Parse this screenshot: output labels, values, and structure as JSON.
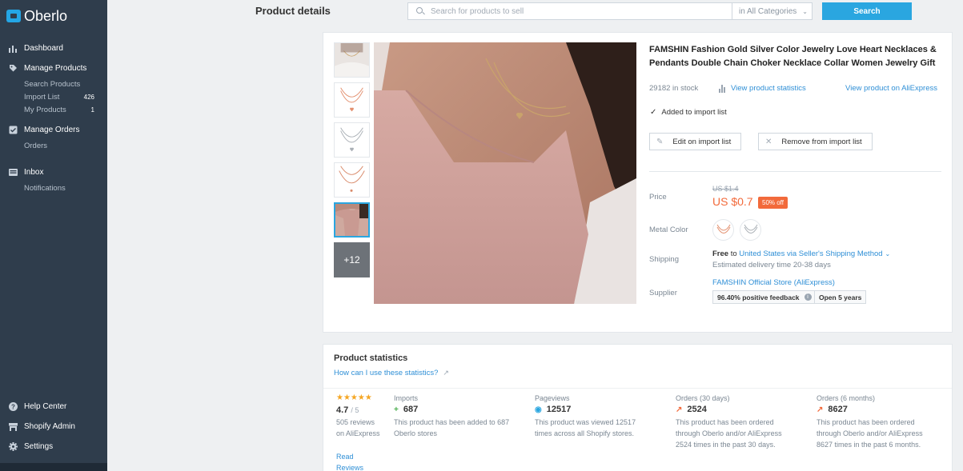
{
  "brand": {
    "name": "Oberlo"
  },
  "sidebar": {
    "sections": [
      {
        "label": "Dashboard",
        "icon": "bar-chart-icon",
        "items": []
      },
      {
        "label": "Manage Products",
        "icon": "tag-icon",
        "items": [
          {
            "label": "Search Products",
            "count": ""
          },
          {
            "label": "Import List",
            "count": "426"
          },
          {
            "label": "My Products",
            "count": "1"
          }
        ]
      },
      {
        "label": "Manage Orders",
        "icon": "checkbox-icon",
        "items": [
          {
            "label": "Orders",
            "count": ""
          }
        ]
      },
      {
        "label": "Inbox",
        "icon": "inbox-icon",
        "items": [
          {
            "label": "Notifications",
            "count": ""
          }
        ]
      }
    ],
    "bottom": [
      {
        "label": "Help Center",
        "icon": "help-icon"
      },
      {
        "label": "Shopify Admin",
        "icon": "store-icon"
      },
      {
        "label": "Settings",
        "icon": "gear-icon"
      }
    ]
  },
  "header": {
    "title": "Product details",
    "search_placeholder": "Search for products to sell",
    "category": "in All Categories",
    "search_button": "Search"
  },
  "product": {
    "title": "FAMSHIN Fashion Gold Silver Color Jewelry Love Heart Necklaces & Pendants Double Chain Choker Necklace Collar Women Jewelry Gift",
    "stock": "29182 in stock",
    "stats_link": "View product statistics",
    "aliexpress_link": "View product on AliExpress",
    "added_text": "Added to import list",
    "edit_button": "Edit on import list",
    "remove_button": "Remove from import list",
    "more_images": "+12",
    "price_label": "Price",
    "old_price": "US $1.4",
    "new_price": "US $0.7",
    "discount": "50% off",
    "metal_color_label": "Metal Color",
    "shipping_label": "Shipping",
    "shipping_free": "Free",
    "shipping_to": "to",
    "shipping_link": "United States via Seller's Shipping Method",
    "shipping_eta": "Estimated delivery time 20-38 days",
    "supplier_label": "Supplier",
    "supplier_name": "FAMSHIN Official Store (AliExpress)",
    "feedback": "96.40% positive feedback",
    "store_age": "Open 5 years"
  },
  "stats": {
    "title": "Product statistics",
    "help_link": "How can I use these statistics?",
    "stars": "★★★★★",
    "rating": "4.7",
    "rating_of": "/ 5",
    "reviews_text": "505 reviews on AliExpress",
    "reviews_link": "Read Reviews",
    "columns": [
      {
        "label": "Imports",
        "icon": "plus-icon",
        "value": "687",
        "desc": "This product has been added to 687 Oberlo stores"
      },
      {
        "label": "Pageviews",
        "icon": "eye-icon",
        "value": "12517",
        "desc": "This product was viewed 12517 times across all Shopify stores."
      },
      {
        "label": "Orders (30 days)",
        "icon": "trend-chart-icon",
        "value": "2524",
        "desc": "This product has been ordered through Oberlo and/or AliExpress 2524 times in the past 30 days."
      },
      {
        "label": "Orders (6 months)",
        "icon": "trend-chart-icon",
        "value": "8627",
        "desc": "This product has been ordered through Oberlo and/or AliExpress 8627 times in the past 6 months."
      }
    ]
  },
  "colors": {
    "accent": "#2aa6e0",
    "sidebar": "#2f3d4c",
    "price": "#f26a3b",
    "link": "#2f8fd6"
  }
}
